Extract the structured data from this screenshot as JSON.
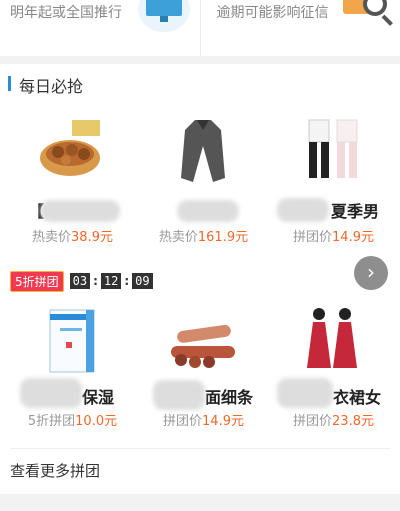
{
  "top_cards": {
    "left_text": "明年起或全国推行",
    "right_text": "逾期可能影响征信",
    "left_icon": "monitor-icon",
    "right_icon": "magnifier-icon"
  },
  "daily_deals": {
    "title": "每日必抢",
    "accent_color": "#2a8cd8",
    "items": [
      {
        "name": "【",
        "price_label": "热卖价",
        "price": "38.9元",
        "icon": "nut-snack-image"
      },
      {
        "name": "",
        "price_label": "热卖价",
        "price": "161.9元",
        "icon": "gray-coat-image"
      },
      {
        "name": "夏季男",
        "price_label": "拼团价",
        "price": "14.9元",
        "icon": "couple-outfit-image"
      }
    ]
  },
  "group_buy": {
    "badge": "5折拼团",
    "countdown": {
      "hours": "03",
      "minutes": "12",
      "seconds": "09"
    },
    "items": [
      {
        "name": "保湿",
        "price_label": "5折拼团",
        "price": "10.0元",
        "icon": "skincare-box-image"
      },
      {
        "name": "面细条",
        "price_label": "拼团价",
        "price": "14.9元",
        "icon": "sausage-snack-image"
      },
      {
        "name": "衣裙女",
        "price_label": "拼团价",
        "price": "23.8元",
        "icon": "red-dress-image"
      }
    ]
  },
  "more_link": "查看更多拼团",
  "colors": {
    "price": "#f0682a",
    "badge": "#f03a52"
  }
}
